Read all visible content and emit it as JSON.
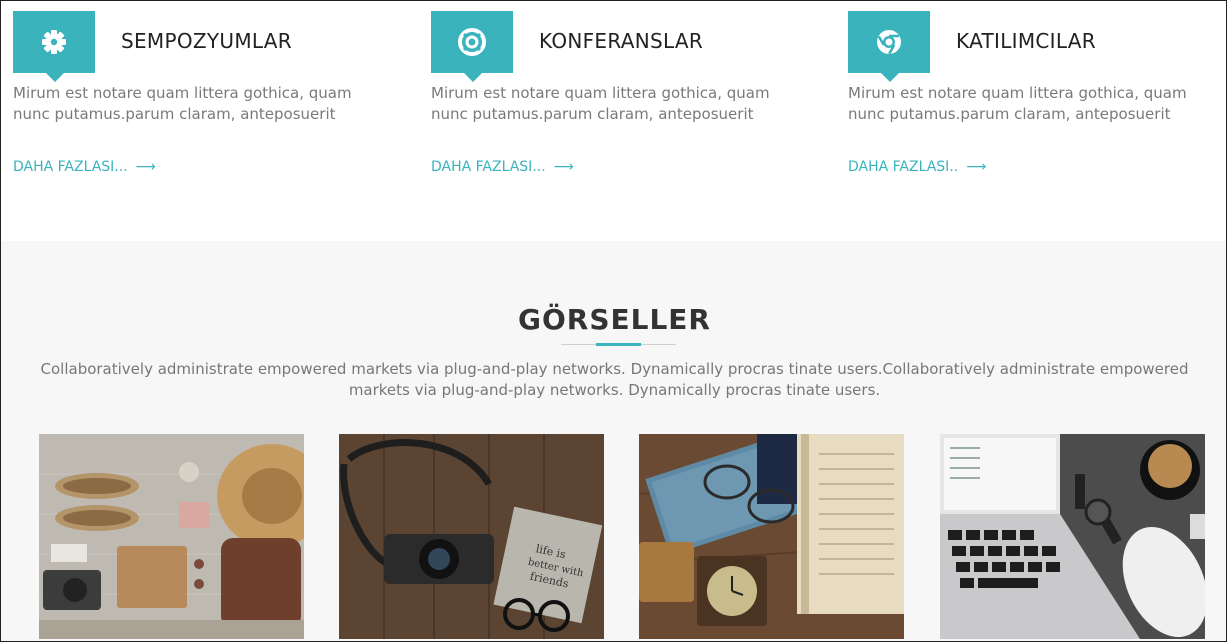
{
  "services": [
    {
      "title": "SEMPOZYUMLAR",
      "icon": "gear-icon",
      "description": "Mirum est notare quam littera gothica, quam nunc putamus.parum claram, anteposuerit",
      "more_label": "DAHA FAZLASI...",
      "arrow": "⟶"
    },
    {
      "title": "KONFERANSLAR",
      "icon": "life-ring-icon",
      "description": "Mirum est notare quam littera gothica, quam nunc putamus.parum claram, anteposuerit",
      "more_label": "DAHA FAZLASI...",
      "arrow": "⟶"
    },
    {
      "title": "KATILIMCILAR",
      "icon": "chrome-icon",
      "description": "Mirum est notare quam littera gothica, quam nunc putamus.parum claram, anteposuerit",
      "more_label": "DAHA FAZLASI..",
      "arrow": "⟶"
    }
  ],
  "gallery": {
    "title": "GÖRSELLER",
    "lead": "Collaboratively administrate empowered markets via plug-and-play networks. Dynamically procras tinate users.Collaboratively administrate empowered markets via plug-and-play networks. Dynamically procras tinate users.",
    "images": [
      {
        "name": "travel-flatlay-image"
      },
      {
        "name": "camera-notebook-image"
      },
      {
        "name": "glasses-book-image"
      },
      {
        "name": "laptop-coffee-image"
      }
    ]
  },
  "colors": {
    "accent": "#3ab3bd",
    "gallery_bg": "#f7f7f7"
  }
}
